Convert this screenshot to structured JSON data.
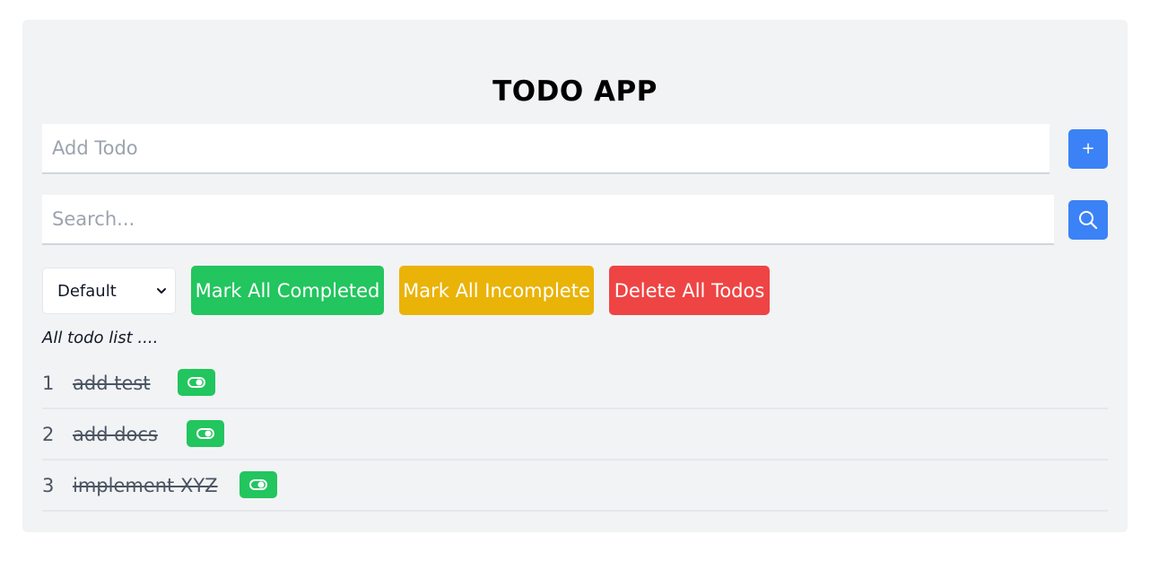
{
  "app": {
    "title": "TODO APP"
  },
  "add": {
    "placeholder": "Add Todo",
    "button_label": "+"
  },
  "search": {
    "placeholder": "Search..."
  },
  "filter": {
    "selected": "Default"
  },
  "actions": {
    "mark_all_completed": "Mark All Completed",
    "mark_all_incomplete": "Mark All Incomplete",
    "delete_all": "Delete All Todos"
  },
  "list": {
    "subtitle": "All todo list ....",
    "items": [
      {
        "number": "1",
        "text": "add test",
        "completed": true
      },
      {
        "number": "2",
        "text": "add docs",
        "completed": true
      },
      {
        "number": "3",
        "text": "implement XYZ",
        "completed": true
      }
    ]
  },
  "colors": {
    "primary": "#3b82f6",
    "success": "#22c55e",
    "warning": "#eab308",
    "danger": "#ef4444",
    "background": "#f2f3f5"
  },
  "icons": {
    "add": "plus-icon",
    "search": "search-icon",
    "toggle": "toggle-on-icon",
    "select": "chevron-down-icon"
  }
}
